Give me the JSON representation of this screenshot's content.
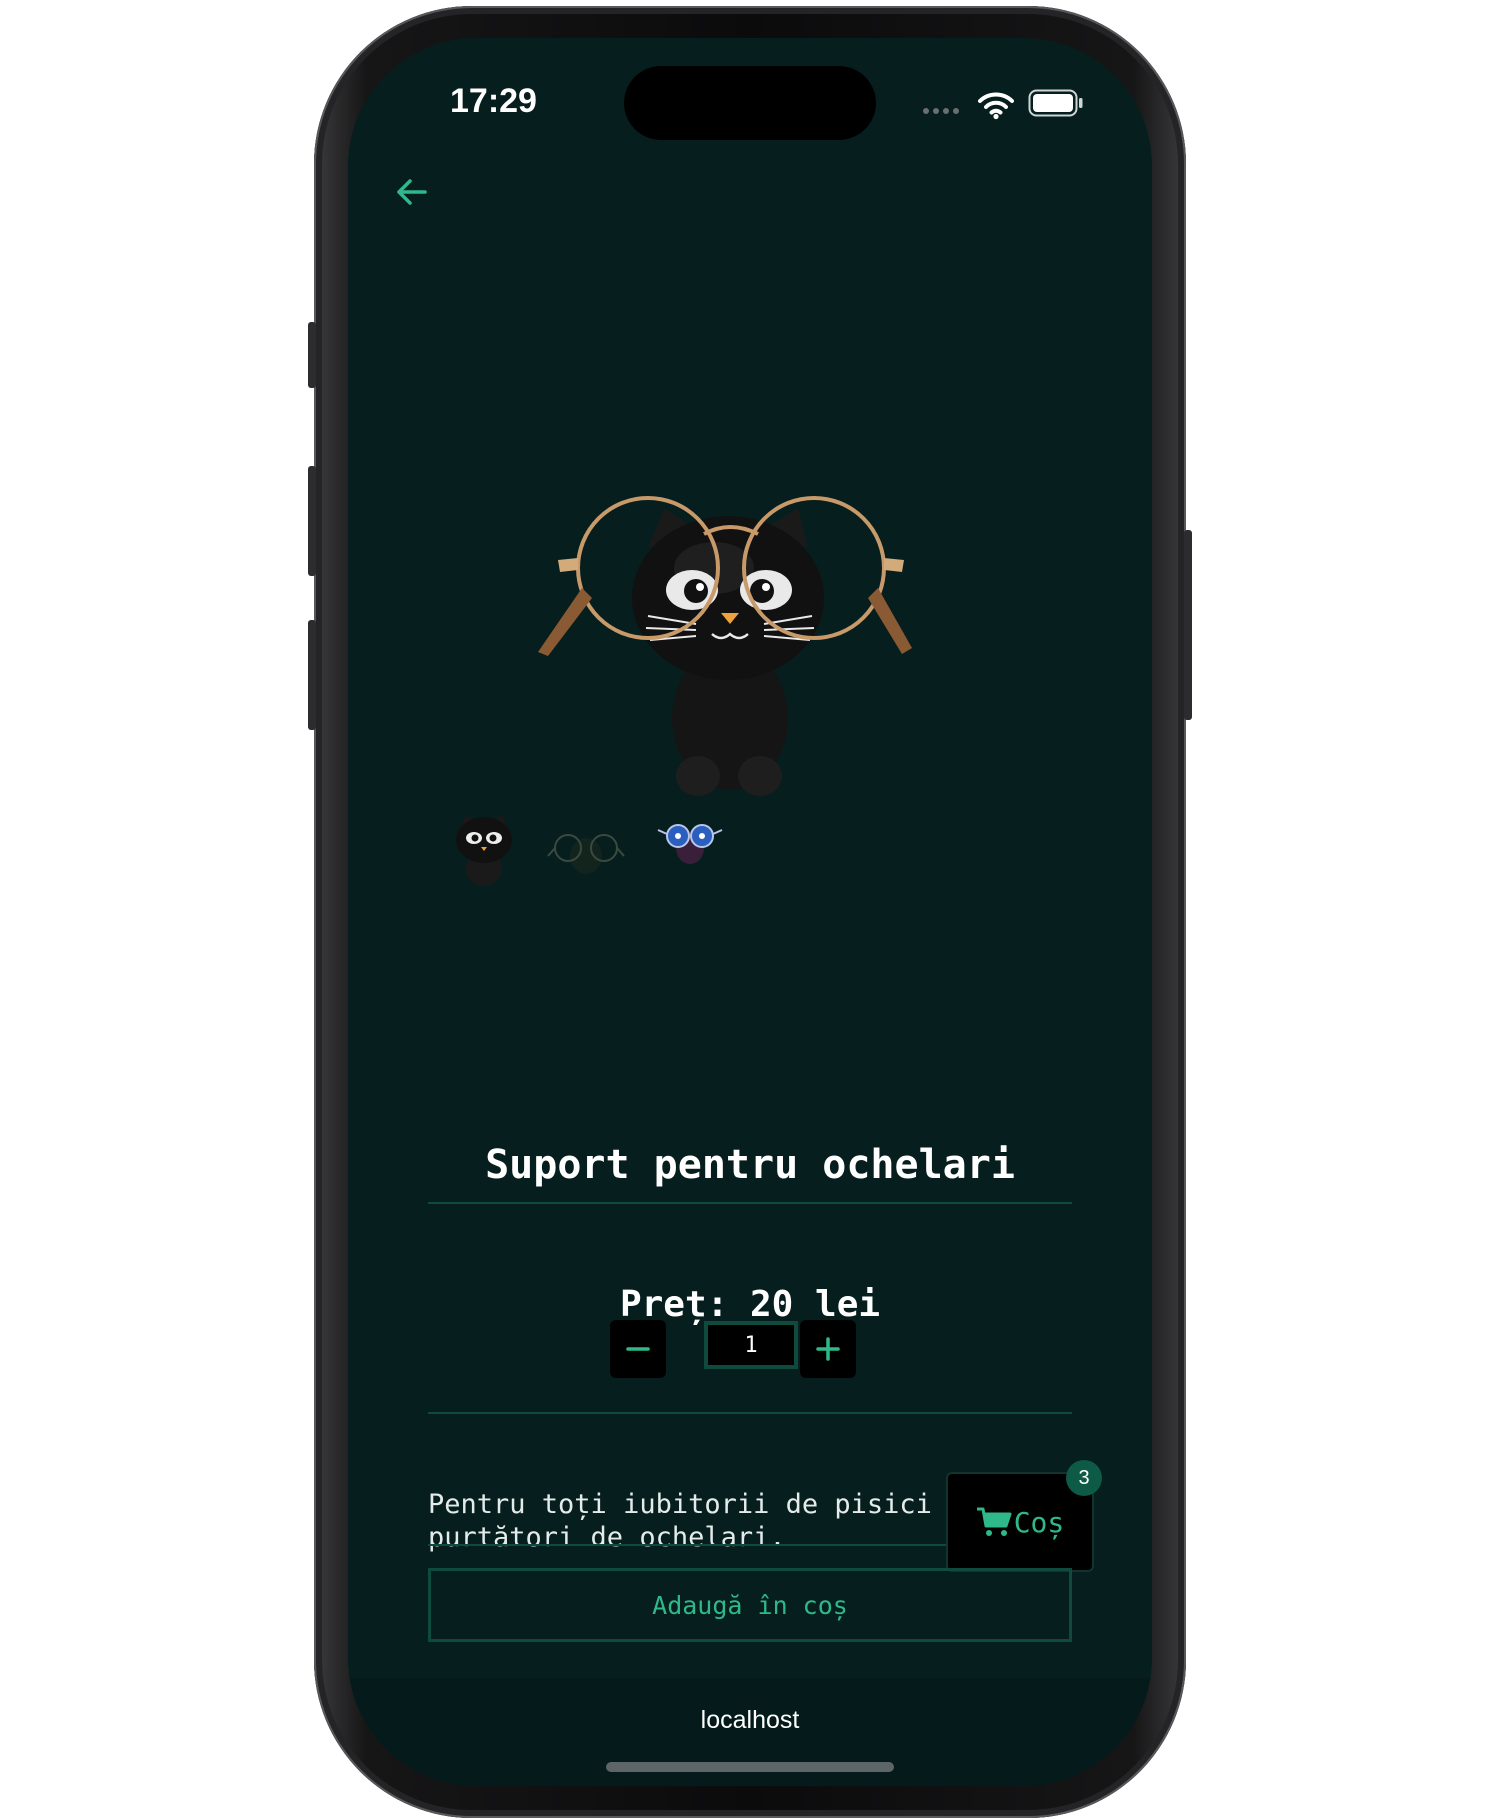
{
  "status_bar": {
    "time": "17:29"
  },
  "icons": {
    "back": "arrow-left-icon",
    "wifi": "wifi-icon",
    "battery": "battery-icon",
    "cart": "shopping-cart-icon",
    "minus": "minus-icon",
    "plus": "plus-icon"
  },
  "product": {
    "title": "Suport pentru ochelari",
    "price": "Preț: 20 lei",
    "quantity": "1",
    "description_line1": "Pentru toți iubitorii de pisici",
    "description_line2": "purtători de ochelari.",
    "add_to_cart_label": "Adaugă în coș",
    "thumbnail_count": 3
  },
  "cart": {
    "label": "Coș",
    "count": "3"
  },
  "browser": {
    "address": "localhost"
  },
  "colors": {
    "background": "#061e1e",
    "accent": "#2fb98a",
    "border": "#0f4a3e",
    "badge": "#0d5a47"
  }
}
